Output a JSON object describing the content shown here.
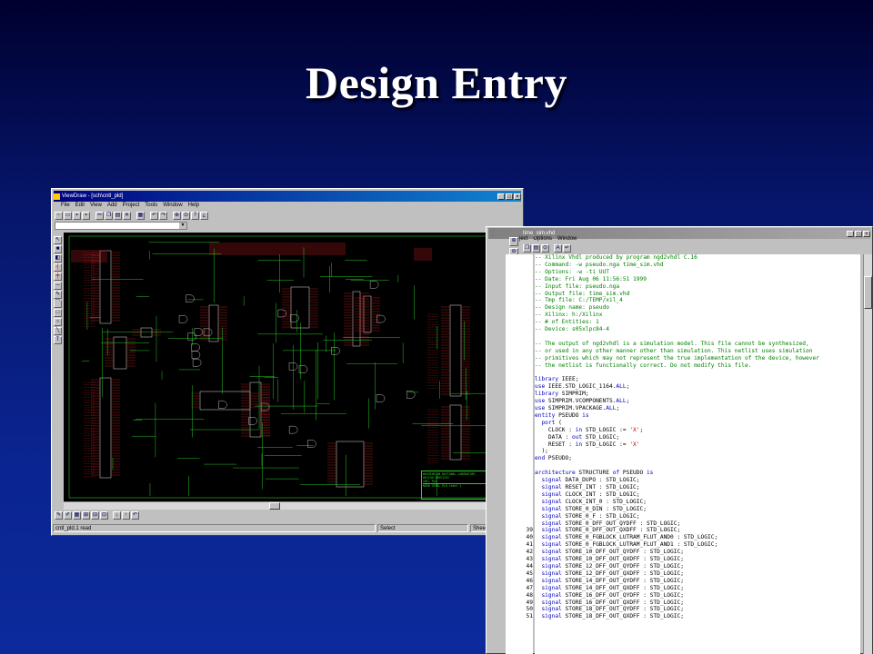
{
  "slide": {
    "title": "Design Entry"
  },
  "schematic_window": {
    "title": "ViewDraw - [sch\\cntl_pld]",
    "menu": [
      "File",
      "Edit",
      "View",
      "Add",
      "Project",
      "Tools",
      "Window",
      "Help"
    ],
    "status": {
      "file": "cntl_pld.1 read",
      "mode": "Select",
      "sheet": "Sheet 1"
    },
    "title_block": {
      "line1": "WASHINGTON NATIONAL LABORATORY",
      "line2": "DESIGN SERVICES",
      "line3": "CNTL PLD",
      "line4": "NOEW CNTRL PLD sheet 1"
    }
  },
  "editor_window": {
    "title": "time_sim.vhd",
    "menu": [
      "ject",
      "Options",
      "Window"
    ],
    "header_comments": [
      "-- Xilinx Vhdl produced by program ngd2vhdl C.16",
      "-- Command: -w pseudo.nga time_sim.vhd",
      "-- Options: -w -ti UUT",
      "-- Date: Fri Aug 06 11:56:51 1999",
      "-- Input file: pseudo.nga",
      "-- Output file: time_sim.vhd",
      "-- Tmp file: C:/TEMP/xil_4",
      "-- Design name: pseudo",
      "-- Xilinx: h:/Xilinx",
      "-- # of Entities: 1",
      "-- Device: s05xlpc84-4"
    ],
    "notice_comments": [
      "-- The output of ngd2vhdl is a simulation model. This file cannot be synthesized,",
      "-- or used in any other manner other than simulation. This netlist uses simulation",
      "-- primitives which may not represent the true implementation of the device, however",
      "-- the netlist is functionally correct. Do not modify this file."
    ],
    "library_lines": [
      [
        "library",
        " IEEE;"
      ],
      [
        "use",
        " IEEE.STD_LOGIC_1164.",
        "ALL",
        ";"
      ],
      [
        "library",
        " SIMPRIM;"
      ],
      [
        "use",
        " SIMPRIM.VCOMPONENTS.",
        "ALL",
        ";"
      ],
      [
        "use",
        " SIMPRIM.VPACKAGE.",
        "ALL",
        ";"
      ]
    ],
    "entity": {
      "name": "PSEUDO",
      "ports": [
        [
          "CLOCK : ",
          "in",
          " STD_LOGIC := ",
          "'X'",
          ";"
        ],
        [
          "DATA : ",
          "out",
          " STD_LOGIC;",
          "",
          ""
        ],
        [
          "RESET : ",
          "in",
          " STD_LOGIC := ",
          "'X'",
          ""
        ]
      ]
    },
    "architecture": "architecture STRUCTURE of PSEUDO is",
    "signals": [
      "DATA_DUPO : STD_LOGIC;",
      "RESET_INT : STD_LOGIC;",
      "CLOCK_INT : STD_LOGIC;",
      "CLOCK_INT_0 : STD_LOGIC;",
      "STORE_0_DIN : STD_LOGIC;",
      "STORE_0_F : STD_LOGIC;",
      "STORE_0_DFF_OUT_QYDFF : STD_LOGIC;",
      "STORE_0_DFF_OUT_QXDFF : STD_LOGIC;",
      "STORE_0_FGBLOCK_LUTRAM_FLUT_AND0 : STD_LOGIC;",
      "STORE_0_FGBLOCK_LUTRAM_FLUT_AND1 : STD_LOGIC;",
      "STORE_10_DFF_OUT_QYDFF : STD_LOGIC;",
      "STORE_10_DFF_OUT_QXDFF : STD_LOGIC;",
      "STORE_12_DFF_OUT_QYDFF : STD_LOGIC;",
      "STORE_12_DFF_OUT_QXDFF : STD_LOGIC;",
      "STORE_14_DFF_OUT_QYDFF : STD_LOGIC;",
      "STORE_14_DFF_OUT_QXDFF : STD_LOGIC;",
      "STORE_16_DFF_OUT_QYDFF : STD_LOGIC;",
      "STORE_16_DFF_OUT_QXDFF : STD_LOGIC;",
      "STORE_18_DFF_OUT_QYDFF : STD_LOGIC;",
      "STORE_18_DFF_OUT_QXDFF : STD_LOGIC;"
    ],
    "line_numbers": [
      "39",
      "40",
      "41",
      "42",
      "43",
      "44",
      "45",
      "46",
      "47",
      "48",
      "49",
      "50",
      "51"
    ],
    "colors": {
      "comment": "#008000",
      "keyword": "#0000c0",
      "string": "#c00000"
    }
  }
}
